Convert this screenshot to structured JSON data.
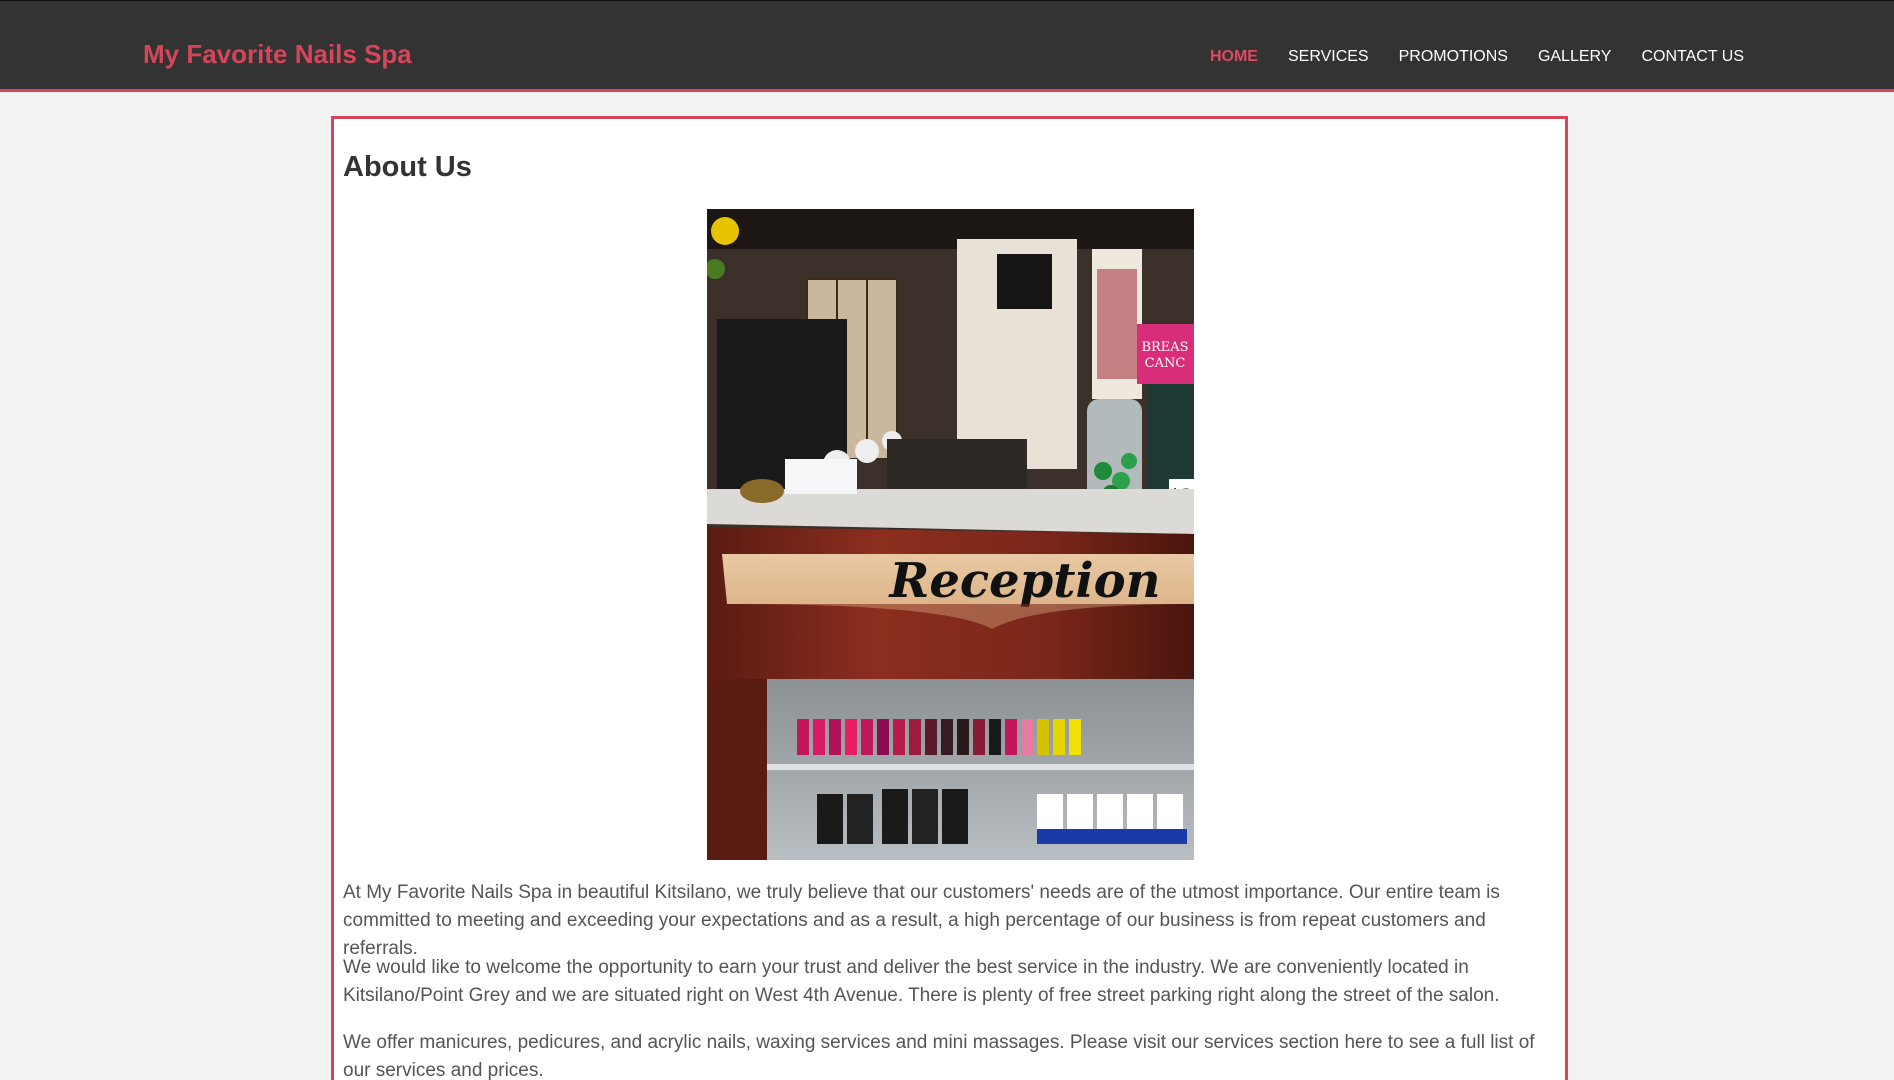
{
  "header": {
    "brand": "My Favorite Nails Spa",
    "nav": [
      {
        "label": "HOME",
        "active": true
      },
      {
        "label": "SERVICES",
        "active": false
      },
      {
        "label": "PROMOTIONS",
        "active": false
      },
      {
        "label": "GALLERY",
        "active": false
      },
      {
        "label": "CONTACT US",
        "active": false
      }
    ]
  },
  "main": {
    "title": "About Us",
    "photo": {
      "sign_text": "Reception",
      "poster_text_1": "BREAS",
      "poster_text_2": "CANC",
      "price_text": "$3"
    },
    "paragraphs": [
      "At My Favorite Nails Spa in beautiful Kitsilano, we truly believe that our customers' needs are of the utmost importance. Our entire team is committed to meeting and exceeding your expectations and as a result, a high percentage of our business is from repeat customers and referrals.",
      "We would like to welcome the opportunity to earn your trust and deliver the best service in the industry. We are conveniently located in Kitsilano/Point Grey and we are situated right on West 4th Avenue. There is plenty of free street parking right along the street of the salon.",
      "We offer manicures, pedicures, and acrylic nails, waxing services and mini massages. Please visit our services section here to see a full list of our services and prices."
    ]
  },
  "colors": {
    "accent": "#d6455a",
    "header_bg": "#333333",
    "page_bg": "#f2f2f2"
  }
}
